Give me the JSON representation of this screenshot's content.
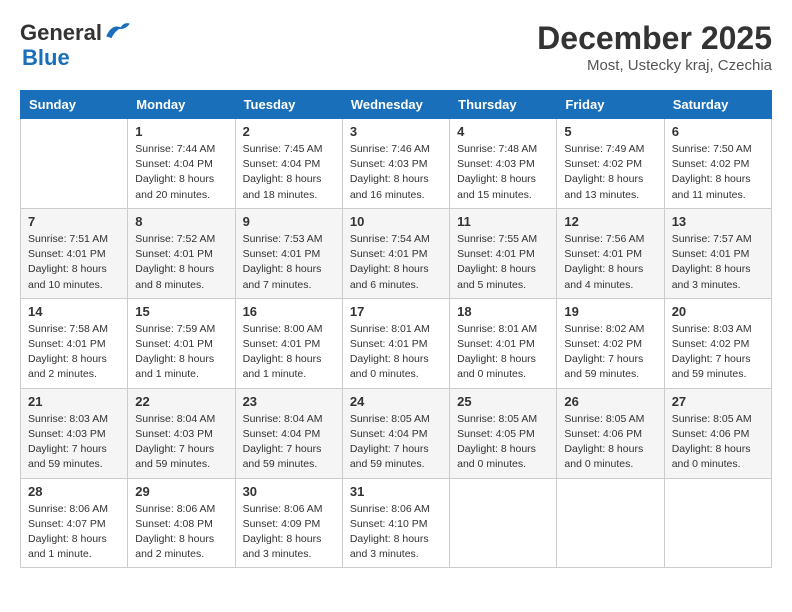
{
  "logo": {
    "general": "General",
    "blue": "Blue"
  },
  "title": {
    "month_year": "December 2025",
    "location": "Most, Ustecky kraj, Czechia"
  },
  "days_of_week": [
    "Sunday",
    "Monday",
    "Tuesday",
    "Wednesday",
    "Thursday",
    "Friday",
    "Saturday"
  ],
  "weeks": [
    [
      {
        "day": "",
        "info": ""
      },
      {
        "day": "1",
        "info": "Sunrise: 7:44 AM\nSunset: 4:04 PM\nDaylight: 8 hours\nand 20 minutes."
      },
      {
        "day": "2",
        "info": "Sunrise: 7:45 AM\nSunset: 4:04 PM\nDaylight: 8 hours\nand 18 minutes."
      },
      {
        "day": "3",
        "info": "Sunrise: 7:46 AM\nSunset: 4:03 PM\nDaylight: 8 hours\nand 16 minutes."
      },
      {
        "day": "4",
        "info": "Sunrise: 7:48 AM\nSunset: 4:03 PM\nDaylight: 8 hours\nand 15 minutes."
      },
      {
        "day": "5",
        "info": "Sunrise: 7:49 AM\nSunset: 4:02 PM\nDaylight: 8 hours\nand 13 minutes."
      },
      {
        "day": "6",
        "info": "Sunrise: 7:50 AM\nSunset: 4:02 PM\nDaylight: 8 hours\nand 11 minutes."
      }
    ],
    [
      {
        "day": "7",
        "info": "Sunrise: 7:51 AM\nSunset: 4:01 PM\nDaylight: 8 hours\nand 10 minutes."
      },
      {
        "day": "8",
        "info": "Sunrise: 7:52 AM\nSunset: 4:01 PM\nDaylight: 8 hours\nand 8 minutes."
      },
      {
        "day": "9",
        "info": "Sunrise: 7:53 AM\nSunset: 4:01 PM\nDaylight: 8 hours\nand 7 minutes."
      },
      {
        "day": "10",
        "info": "Sunrise: 7:54 AM\nSunset: 4:01 PM\nDaylight: 8 hours\nand 6 minutes."
      },
      {
        "day": "11",
        "info": "Sunrise: 7:55 AM\nSunset: 4:01 PM\nDaylight: 8 hours\nand 5 minutes."
      },
      {
        "day": "12",
        "info": "Sunrise: 7:56 AM\nSunset: 4:01 PM\nDaylight: 8 hours\nand 4 minutes."
      },
      {
        "day": "13",
        "info": "Sunrise: 7:57 AM\nSunset: 4:01 PM\nDaylight: 8 hours\nand 3 minutes."
      }
    ],
    [
      {
        "day": "14",
        "info": "Sunrise: 7:58 AM\nSunset: 4:01 PM\nDaylight: 8 hours\nand 2 minutes."
      },
      {
        "day": "15",
        "info": "Sunrise: 7:59 AM\nSunset: 4:01 PM\nDaylight: 8 hours\nand 1 minute."
      },
      {
        "day": "16",
        "info": "Sunrise: 8:00 AM\nSunset: 4:01 PM\nDaylight: 8 hours\nand 1 minute."
      },
      {
        "day": "17",
        "info": "Sunrise: 8:01 AM\nSunset: 4:01 PM\nDaylight: 8 hours\nand 0 minutes."
      },
      {
        "day": "18",
        "info": "Sunrise: 8:01 AM\nSunset: 4:01 PM\nDaylight: 8 hours\nand 0 minutes."
      },
      {
        "day": "19",
        "info": "Sunrise: 8:02 AM\nSunset: 4:02 PM\nDaylight: 7 hours\nand 59 minutes."
      },
      {
        "day": "20",
        "info": "Sunrise: 8:03 AM\nSunset: 4:02 PM\nDaylight: 7 hours\nand 59 minutes."
      }
    ],
    [
      {
        "day": "21",
        "info": "Sunrise: 8:03 AM\nSunset: 4:03 PM\nDaylight: 7 hours\nand 59 minutes."
      },
      {
        "day": "22",
        "info": "Sunrise: 8:04 AM\nSunset: 4:03 PM\nDaylight: 7 hours\nand 59 minutes."
      },
      {
        "day": "23",
        "info": "Sunrise: 8:04 AM\nSunset: 4:04 PM\nDaylight: 7 hours\nand 59 minutes."
      },
      {
        "day": "24",
        "info": "Sunrise: 8:05 AM\nSunset: 4:04 PM\nDaylight: 7 hours\nand 59 minutes."
      },
      {
        "day": "25",
        "info": "Sunrise: 8:05 AM\nSunset: 4:05 PM\nDaylight: 8 hours\nand 0 minutes."
      },
      {
        "day": "26",
        "info": "Sunrise: 8:05 AM\nSunset: 4:06 PM\nDaylight: 8 hours\nand 0 minutes."
      },
      {
        "day": "27",
        "info": "Sunrise: 8:05 AM\nSunset: 4:06 PM\nDaylight: 8 hours\nand 0 minutes."
      }
    ],
    [
      {
        "day": "28",
        "info": "Sunrise: 8:06 AM\nSunset: 4:07 PM\nDaylight: 8 hours\nand 1 minute."
      },
      {
        "day": "29",
        "info": "Sunrise: 8:06 AM\nSunset: 4:08 PM\nDaylight: 8 hours\nand 2 minutes."
      },
      {
        "day": "30",
        "info": "Sunrise: 8:06 AM\nSunset: 4:09 PM\nDaylight: 8 hours\nand 3 minutes."
      },
      {
        "day": "31",
        "info": "Sunrise: 8:06 AM\nSunset: 4:10 PM\nDaylight: 8 hours\nand 3 minutes."
      },
      {
        "day": "",
        "info": ""
      },
      {
        "day": "",
        "info": ""
      },
      {
        "day": "",
        "info": ""
      }
    ]
  ]
}
